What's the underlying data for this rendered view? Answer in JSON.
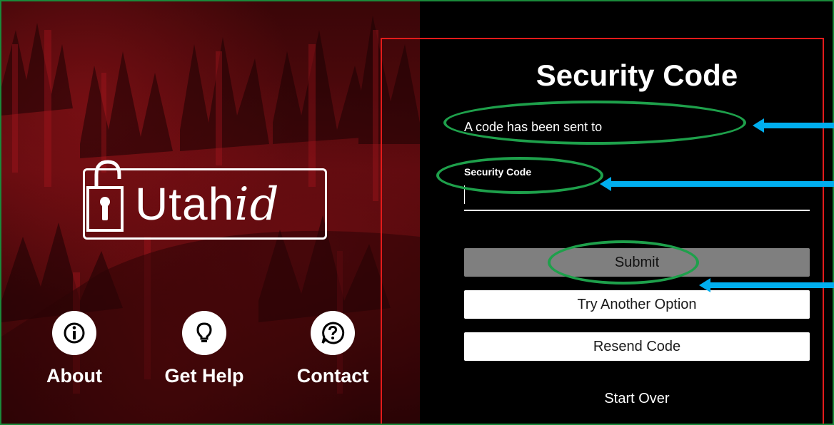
{
  "branding": {
    "logo_word": "Utah",
    "logo_suffix": "id"
  },
  "nav": [
    {
      "label": "About",
      "icon": "info-icon"
    },
    {
      "label": "Get Help",
      "icon": "lightbulb-icon"
    },
    {
      "label": "Contact",
      "icon": "question-icon"
    }
  ],
  "form": {
    "title": "Security Code",
    "sent_message": "A code has been sent to",
    "field_label": "Security Code",
    "code_value": "",
    "submit_label": "Submit",
    "try_another_label": "Try Another Option",
    "resend_label": "Resend Code",
    "start_over_label": "Start Over"
  },
  "colors": {
    "annotation_green": "#1ea04b",
    "annotation_blue": "#00aeef",
    "frame_red": "#e31b1b",
    "submit_gray": "#7f7f7f"
  }
}
